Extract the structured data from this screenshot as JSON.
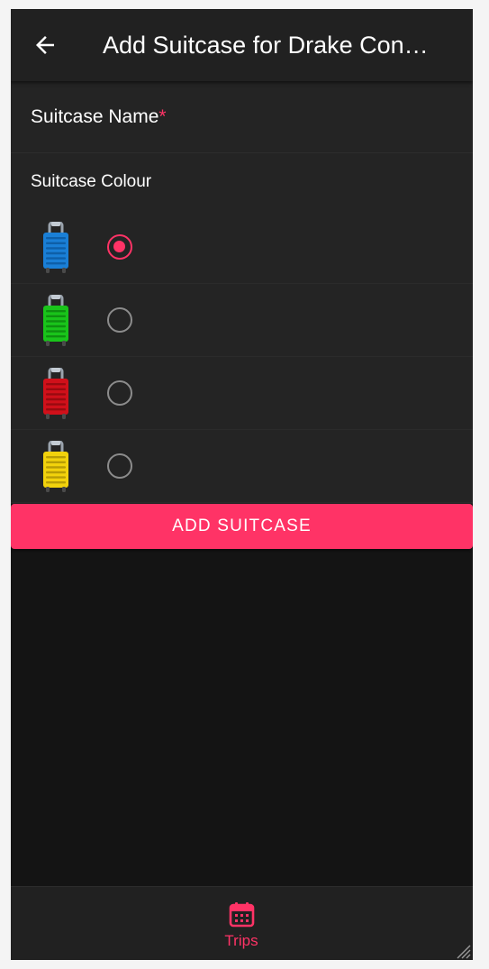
{
  "appbar": {
    "title": "Add Suitcase for Drake Con…",
    "back_icon": "arrow-left-icon"
  },
  "form": {
    "name_label": "Suitcase Name",
    "required_mark": "*",
    "colour_label": "Suitcase Colour",
    "colours": [
      {
        "name": "blue",
        "body": "#1a7fd6",
        "dark": "#0e5fa8",
        "selected": true
      },
      {
        "name": "green",
        "body": "#19c41a",
        "dark": "#0f8f10",
        "selected": false
      },
      {
        "name": "red",
        "body": "#d0101a",
        "dark": "#990a10",
        "selected": false
      },
      {
        "name": "yellow",
        "body": "#f2d20c",
        "dark": "#b89d05",
        "selected": false
      }
    ],
    "submit_label": "ADD SUITCASE"
  },
  "bottom_nav": {
    "items": [
      {
        "label": "Trips",
        "icon": "calendar-icon",
        "active": true
      }
    ]
  },
  "colors": {
    "accent": "#ff3366",
    "surface": "#242424",
    "background": "#141414",
    "appbar": "#212121"
  }
}
